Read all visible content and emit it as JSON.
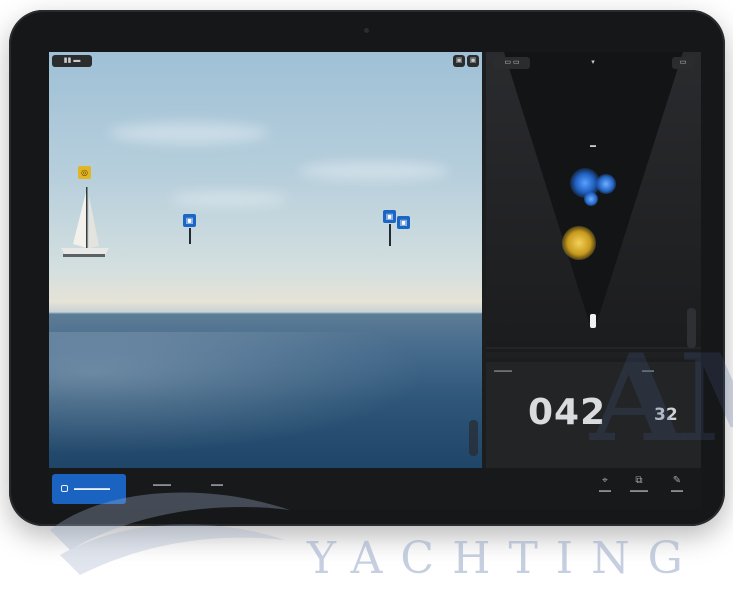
{
  "camera": {
    "top_left_button": "▮▮ ▬",
    "top_right_buttons": [
      "▣",
      "▣"
    ],
    "markers": [
      {
        "name": "sailboat",
        "kind": "yellow",
        "glyph": "◎"
      },
      {
        "name": "target-1",
        "kind": "blue",
        "glyph": "▣"
      },
      {
        "name": "target-2",
        "kind": "blue",
        "glyph": "▣"
      },
      {
        "name": "target-3",
        "kind": "blue",
        "glyph": "▣"
      }
    ]
  },
  "radar": {
    "header_left": "▭ ▭",
    "header_center": "▾",
    "header_right": "▭",
    "range_label": "▬"
  },
  "data_panel": {
    "heading_label": "▬▬▬",
    "heading_value": "042",
    "speed_label": "▬▬",
    "speed_value": "32"
  },
  "bottom_bar": {
    "primary_button": "▬▬▬▬▬▬",
    "tabs": [
      "▬▬▬",
      "▬▬"
    ],
    "tools": [
      {
        "glyph": "⌖",
        "label": "▬▬"
      },
      {
        "glyph": "⧉",
        "label": "▬▬▬"
      },
      {
        "glyph": "✎",
        "label": "▬▬"
      }
    ]
  },
  "watermark": {
    "brand_initials": "AMZ",
    "brand_word": "YACHTING"
  },
  "colors": {
    "accent_blue": "#1a63c0",
    "marker_yellow": "#e2b524",
    "bezel": "#161718"
  }
}
